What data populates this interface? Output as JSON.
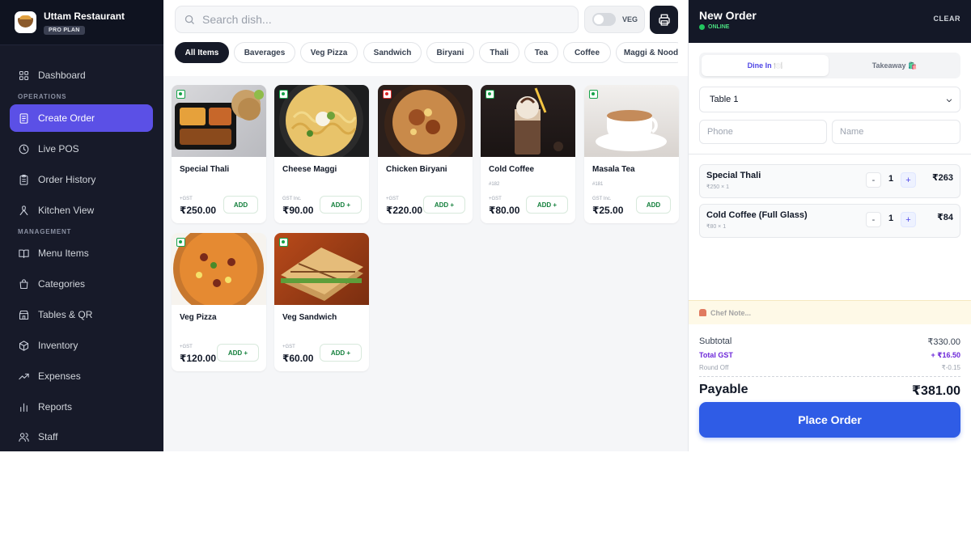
{
  "brand": {
    "name": "Uttam Restaurant",
    "plan": "PRO PLAN"
  },
  "nav": {
    "dashboard": "Dashboard",
    "section_operations": "OPERATIONS",
    "create_order": "Create Order",
    "live_pos": "Live POS",
    "order_history": "Order History",
    "kitchen_view": "Kitchen View",
    "section_management": "MANAGEMENT",
    "menu_items": "Menu Items",
    "categories": "Categories",
    "tables_qr": "Tables & QR",
    "inventory": "Inventory",
    "expenses": "Expenses",
    "reports": "Reports",
    "staff": "Staff"
  },
  "search": {
    "placeholder": "Search dish..."
  },
  "veg_toggle": {
    "label": "VEG",
    "on": false
  },
  "categories": [
    "All Items",
    "Baverages",
    "Veg Pizza",
    "Sandwich",
    "Biryani",
    "Thali",
    "Tea",
    "Coffee",
    "Maggi & Nood"
  ],
  "items": [
    {
      "name": "Special Thali",
      "code": "",
      "tax": "+GST",
      "price": "₹250.00",
      "add": "ADD",
      "veg": true
    },
    {
      "name": "Cheese Maggi",
      "code": "",
      "tax": "GST Inc.",
      "price": "₹90.00",
      "add": "ADD +",
      "veg": true
    },
    {
      "name": "Chicken Biryani",
      "code": "",
      "tax": "+GST",
      "price": "₹220.00",
      "add": "ADD +",
      "veg": false
    },
    {
      "name": "Cold Coffee",
      "code": "#182",
      "tax": "+GST",
      "price": "₹80.00",
      "add": "ADD +",
      "veg": true
    },
    {
      "name": "Masala Tea",
      "code": "#181",
      "tax": "GST Inc.",
      "price": "₹25.00",
      "add": "ADD",
      "veg": true
    },
    {
      "name": "Veg Pizza",
      "code": "",
      "tax": "+GST",
      "price": "₹120.00",
      "add": "ADD +",
      "veg": true
    },
    {
      "name": "Veg Sandwich",
      "code": "",
      "tax": "+GST",
      "price": "₹60.00",
      "add": "ADD +",
      "veg": true
    }
  ],
  "order": {
    "title": "New Order",
    "status": "ONLINE",
    "clear": "CLEAR",
    "dine_in": "Dine In 🍽️",
    "takeaway": "Takeaway 🛍️",
    "table": "Table 1",
    "phone_placeholder": "Phone",
    "name_placeholder": "Name",
    "lines": [
      {
        "name": "Special Thali",
        "sub": "₹250 × 1",
        "minus": "-",
        "qty": "1",
        "plus": "+",
        "total": "₹263"
      },
      {
        "name": "Cold Coffee (Full Glass)",
        "sub": "₹80 × 1",
        "minus": "-",
        "qty": "1",
        "plus": "+",
        "total": "₹84"
      }
    ],
    "chef_note": "Chef Note...",
    "subtotal_label": "Subtotal",
    "subtotal": "₹330.00",
    "gst_label": "Total GST",
    "gst": "+ ₹16.50",
    "round_label": "Round Off",
    "round": "₹-0.15",
    "payable_label": "Payable",
    "payable": "₹381.00",
    "place_order": "Place Order"
  },
  "colors": {
    "accent": "#5b50e6",
    "primary_button": "#2f5ce6",
    "sidebar": "#171a29",
    "veg": "#16a34a",
    "nonveg": "#dc2626"
  }
}
